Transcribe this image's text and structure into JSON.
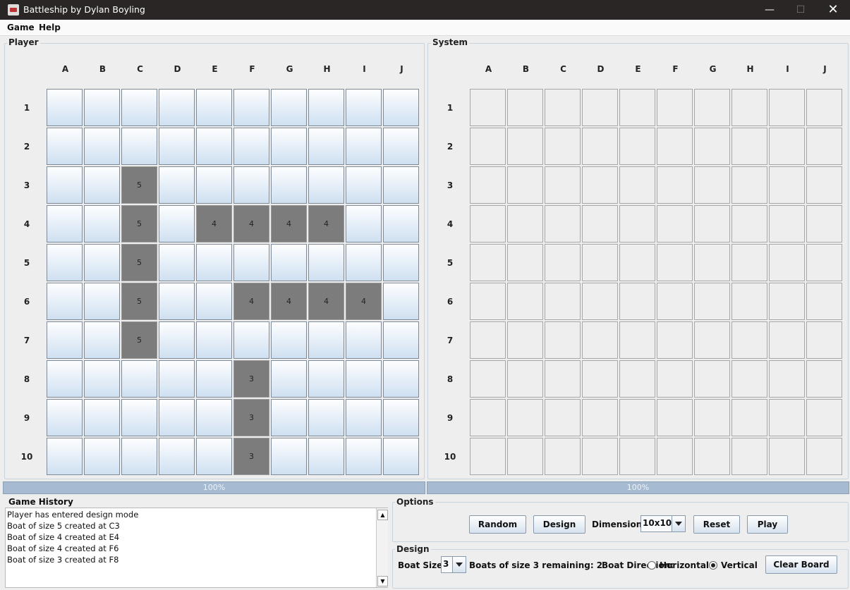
{
  "window": {
    "title": "Battleship by Dylan Boyling",
    "minimize": "—",
    "maximize": "☐",
    "close": "✕"
  },
  "menu": [
    "Game",
    "Help"
  ],
  "columns": [
    "A",
    "B",
    "C",
    "D",
    "E",
    "F",
    "G",
    "H",
    "I",
    "J"
  ],
  "rows": [
    "1",
    "2",
    "3",
    "4",
    "5",
    "6",
    "7",
    "8",
    "9",
    "10"
  ],
  "player": {
    "title": "Player",
    "progress": "100%",
    "boats": [
      {
        "row": 3,
        "col": 3,
        "label": "5"
      },
      {
        "row": 4,
        "col": 3,
        "label": "5"
      },
      {
        "row": 5,
        "col": 3,
        "label": "5"
      },
      {
        "row": 6,
        "col": 3,
        "label": "5"
      },
      {
        "row": 7,
        "col": 3,
        "label": "5"
      },
      {
        "row": 4,
        "col": 5,
        "label": "4"
      },
      {
        "row": 4,
        "col": 6,
        "label": "4"
      },
      {
        "row": 4,
        "col": 7,
        "label": "4"
      },
      {
        "row": 4,
        "col": 8,
        "label": "4"
      },
      {
        "row": 6,
        "col": 6,
        "label": "4"
      },
      {
        "row": 6,
        "col": 7,
        "label": "4"
      },
      {
        "row": 6,
        "col": 8,
        "label": "4"
      },
      {
        "row": 6,
        "col": 9,
        "label": "4"
      },
      {
        "row": 8,
        "col": 6,
        "label": "3"
      },
      {
        "row": 9,
        "col": 6,
        "label": "3"
      },
      {
        "row": 10,
        "col": 6,
        "label": "3"
      }
    ]
  },
  "system": {
    "title": "System",
    "progress": "100%"
  },
  "history": {
    "title": "Game History",
    "lines": [
      "Player has entered design mode",
      "Boat of size 5 created at C3",
      "Boat of size 4 created at E4",
      "Boat of size 4 created at F6",
      "Boat of size 3 created at F8"
    ]
  },
  "options": {
    "title": "Options",
    "random_label": "Random",
    "design_label": "Design",
    "dimensions_label": "Dimensions:",
    "dimensions_value": "10x10",
    "reset_label": "Reset",
    "play_label": "Play"
  },
  "design": {
    "title": "Design",
    "boat_size_label": "Boat Size:",
    "boat_size_value": "3",
    "remaining_label": "Boats of size 3 remaining: 2",
    "direction_label": "Boat Direction:",
    "horizontal_label": "Horizontal",
    "vertical_label": "Vertical",
    "selected_direction": "Vertical",
    "clear_label": "Clear Board"
  }
}
